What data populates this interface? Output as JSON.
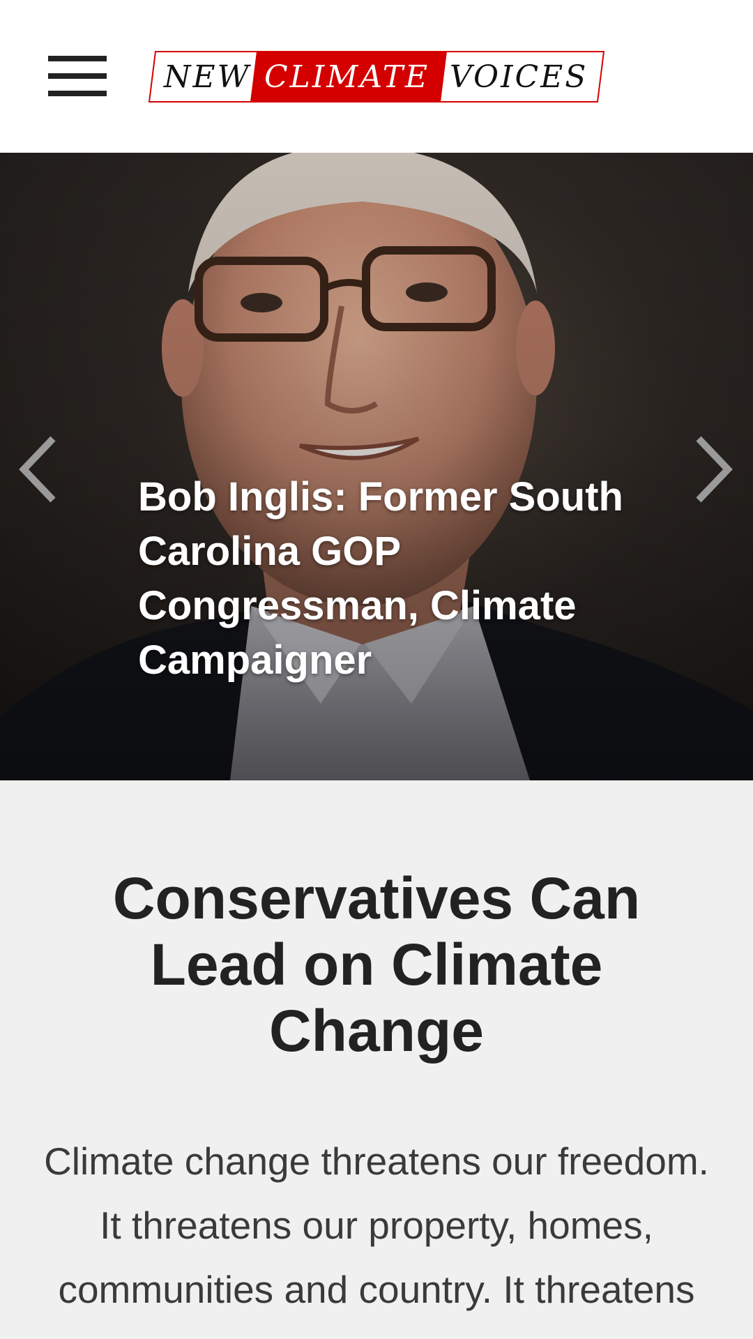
{
  "header": {
    "menu_icon": "hamburger-menu-icon",
    "logo": {
      "word1": "NEW",
      "word2": "CLIMATE",
      "word3": "VOICES",
      "accent_color": "#d40000"
    }
  },
  "hero": {
    "caption": "Bob Inglis: Former South Carolina GOP Congressman, Climate Campaigner",
    "prev_icon": "chevron-left-icon",
    "next_icon": "chevron-right-icon"
  },
  "content": {
    "title": "Conservatives Can Lead on Climate Change",
    "body": "Climate change threatens our freedom. It threatens our property, homes, communities and country. It threatens our health and"
  },
  "colors": {
    "header_bg": "#ffffff",
    "content_bg": "#f0f0f0",
    "text_dark": "#222222",
    "logo_red": "#d40000"
  }
}
